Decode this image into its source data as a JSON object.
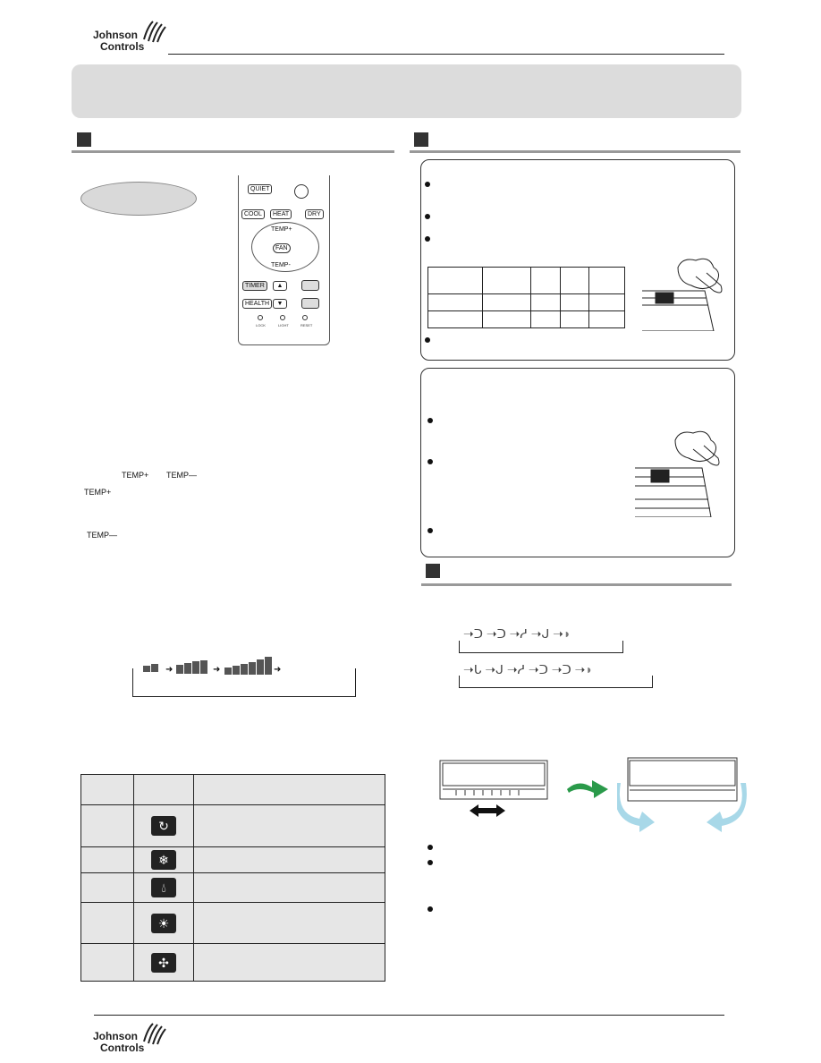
{
  "header": {
    "logo_line1": "Johnson",
    "logo_line2": "Controls"
  },
  "footer": {
    "logo_line1": "Johnson",
    "logo_line2": "Controls"
  },
  "remote": {
    "quiet": "QUIET",
    "cool": "COOL",
    "heat": "HEAT",
    "dry": "DRY",
    "temp_plus": "TEMP+",
    "fan": "FAN",
    "temp_minus": "TEMP-",
    "timer": "TIMER",
    "health": "HEALTH",
    "lock": "LOCK",
    "light": "LIGHT",
    "reset": "RESET"
  },
  "temp_labels": {
    "plus": "TEMP+",
    "minus": "TEMP—"
  },
  "mode_icons": [
    "auto-icon",
    "cool-snowflake-icon",
    "dry-drop-icon",
    "heat-sun-icon",
    "fan-icon"
  ],
  "colors": {
    "banner": "#dcdcdc",
    "swing_arrow": "#2a9a4a",
    "airflow": "#a8d8e8"
  }
}
